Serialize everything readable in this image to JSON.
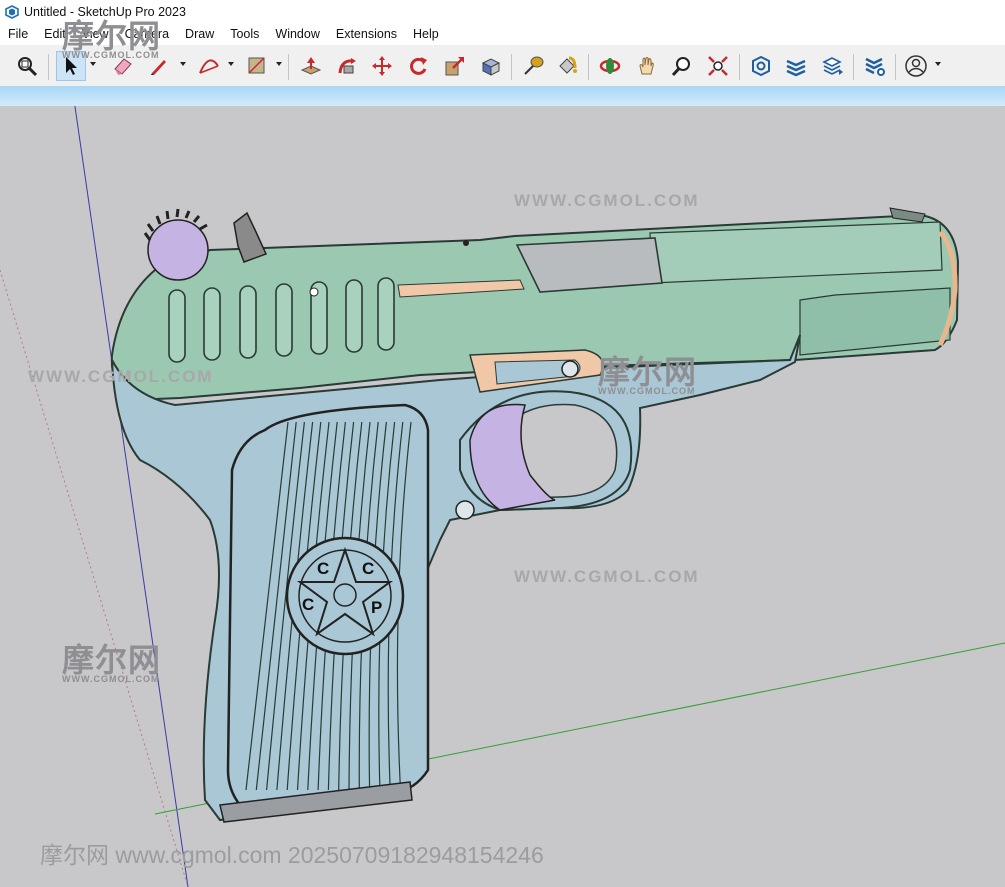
{
  "window": {
    "title": "Untitled - SketchUp Pro 2023"
  },
  "menu": {
    "items": [
      {
        "label": "File"
      },
      {
        "label": "Edit"
      },
      {
        "label": "View"
      },
      {
        "label": "Camera"
      },
      {
        "label": "Draw"
      },
      {
        "label": "Tools"
      },
      {
        "label": "Window"
      },
      {
        "label": "Extensions"
      },
      {
        "label": "Help"
      }
    ]
  },
  "toolbar": {
    "tools": [
      "zoom-window",
      "select",
      "eraser",
      "pencil-line",
      "arc",
      "rectangle",
      "push-pull",
      "follow-me",
      "move",
      "rotate",
      "scale",
      "offset",
      "tape-measure",
      "paint-bucket",
      "orbit",
      "pan",
      "zoom",
      "zoom-extents",
      "3d-warehouse",
      "extension-warehouse",
      "layout",
      "extension-manager",
      "account"
    ],
    "active_tool": "select"
  },
  "model": {
    "emblem_letters": [
      "C",
      "C",
      "C",
      "P"
    ],
    "colors": {
      "slide": "#9bc8b0",
      "frame": "#a9c7d4",
      "accent": "#c5b3e4",
      "orange": "#f0c8a8",
      "sky": "#a9d6f6",
      "ground": "#c8c8ca"
    }
  },
  "watermarks": {
    "site": "WWW.CGMOL.COM",
    "brand_cn": "摩尔网",
    "brand_small": "WWW.CGMOL.COM",
    "footer": "摩尔网 www.cgmol.com 20250709182948154246"
  }
}
